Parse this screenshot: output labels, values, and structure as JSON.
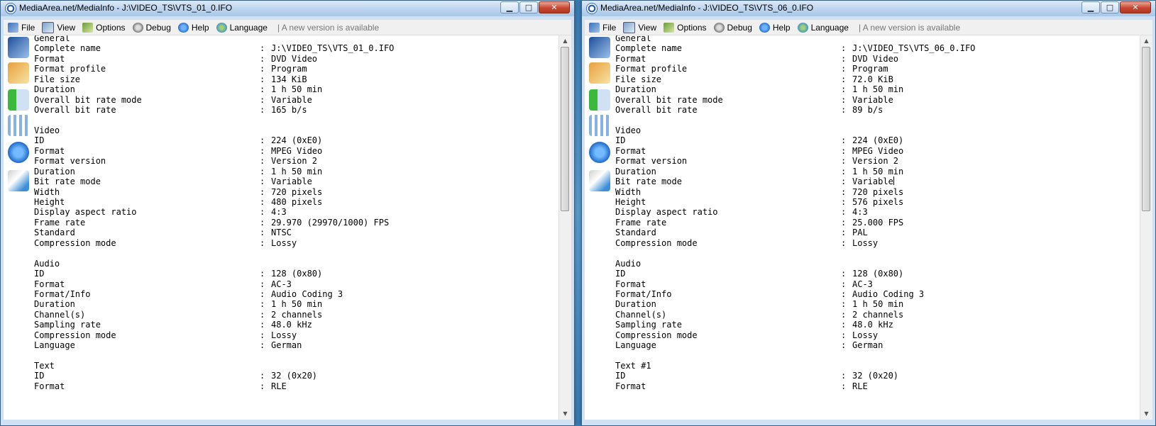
{
  "windows": [
    {
      "title": "MediaArea.net/MediaInfo - J:\\VIDEO_TS\\VTS_01_0.IFO",
      "caption_buttons": {
        "minimize": "▁",
        "maximize": "□",
        "close": "✕"
      },
      "menu": {
        "file": "File",
        "view": "View",
        "options": "Options",
        "debug": "Debug",
        "help": "Help",
        "language": "Language",
        "notice": "| A new version is available"
      },
      "report": [
        {
          "k": "General",
          "v": ""
        },
        {
          "k": "Complete name",
          "v": "J:\\VIDEO_TS\\VTS_01_0.IFO"
        },
        {
          "k": "Format",
          "v": "DVD Video"
        },
        {
          "k": "Format profile",
          "v": "Program"
        },
        {
          "k": "File size",
          "v": "134 KiB"
        },
        {
          "k": "Duration",
          "v": "1 h 50 min"
        },
        {
          "k": "Overall bit rate mode",
          "v": "Variable"
        },
        {
          "k": "Overall bit rate",
          "v": "165 b/s"
        },
        {
          "k": "",
          "v": ""
        },
        {
          "k": "Video",
          "v": ""
        },
        {
          "k": "ID",
          "v": "224 (0xE0)"
        },
        {
          "k": "Format",
          "v": "MPEG Video"
        },
        {
          "k": "Format version",
          "v": "Version 2"
        },
        {
          "k": "Duration",
          "v": "1 h 50 min"
        },
        {
          "k": "Bit rate mode",
          "v": "Variable"
        },
        {
          "k": "Width",
          "v": "720 pixels"
        },
        {
          "k": "Height",
          "v": "480 pixels"
        },
        {
          "k": "Display aspect ratio",
          "v": "4:3"
        },
        {
          "k": "Frame rate",
          "v": "29.970 (29970/1000) FPS"
        },
        {
          "k": "Standard",
          "v": "NTSC"
        },
        {
          "k": "Compression mode",
          "v": "Lossy"
        },
        {
          "k": "",
          "v": ""
        },
        {
          "k": "Audio",
          "v": ""
        },
        {
          "k": "ID",
          "v": "128 (0x80)"
        },
        {
          "k": "Format",
          "v": "AC-3"
        },
        {
          "k": "Format/Info",
          "v": "Audio Coding 3"
        },
        {
          "k": "Duration",
          "v": "1 h 50 min"
        },
        {
          "k": "Channel(s)",
          "v": "2 channels"
        },
        {
          "k": "Sampling rate",
          "v": "48.0 kHz"
        },
        {
          "k": "Compression mode",
          "v": "Lossy"
        },
        {
          "k": "Language",
          "v": "German"
        },
        {
          "k": "",
          "v": ""
        },
        {
          "k": "Text",
          "v": ""
        },
        {
          "k": "ID",
          "v": "32 (0x20)"
        },
        {
          "k": "Format",
          "v": "RLE"
        }
      ]
    },
    {
      "title": "MediaArea.net/MediaInfo - J:\\VIDEO_TS\\VTS_06_0.IFO",
      "caption_buttons": {
        "minimize": "▁",
        "maximize": "□",
        "close": "✕"
      },
      "menu": {
        "file": "File",
        "view": "View",
        "options": "Options",
        "debug": "Debug",
        "help": "Help",
        "language": "Language",
        "notice": "| A new version is available"
      },
      "report": [
        {
          "k": "General",
          "v": ""
        },
        {
          "k": "Complete name",
          "v": "J:\\VIDEO_TS\\VTS_06_0.IFO"
        },
        {
          "k": "Format",
          "v": "DVD Video"
        },
        {
          "k": "Format profile",
          "v": "Program"
        },
        {
          "k": "File size",
          "v": "72.0 KiB"
        },
        {
          "k": "Duration",
          "v": "1 h 50 min"
        },
        {
          "k": "Overall bit rate mode",
          "v": "Variable"
        },
        {
          "k": "Overall bit rate",
          "v": "89 b/s"
        },
        {
          "k": "",
          "v": ""
        },
        {
          "k": "Video",
          "v": ""
        },
        {
          "k": "ID",
          "v": "224 (0xE0)"
        },
        {
          "k": "Format",
          "v": "MPEG Video"
        },
        {
          "k": "Format version",
          "v": "Version 2"
        },
        {
          "k": "Duration",
          "v": "1 h 50 min"
        },
        {
          "k": "Bit rate mode",
          "v": "Variable"
        },
        {
          "k": "Width",
          "v": "720 pixels"
        },
        {
          "k": "Height",
          "v": "576 pixels"
        },
        {
          "k": "Display aspect ratio",
          "v": "4:3"
        },
        {
          "k": "Frame rate",
          "v": "25.000 FPS"
        },
        {
          "k": "Standard",
          "v": "PAL"
        },
        {
          "k": "Compression mode",
          "v": "Lossy"
        },
        {
          "k": "",
          "v": ""
        },
        {
          "k": "Audio",
          "v": ""
        },
        {
          "k": "ID",
          "v": "128 (0x80)"
        },
        {
          "k": "Format",
          "v": "AC-3"
        },
        {
          "k": "Format/Info",
          "v": "Audio Coding 3"
        },
        {
          "k": "Duration",
          "v": "1 h 50 min"
        },
        {
          "k": "Channel(s)",
          "v": "2 channels"
        },
        {
          "k": "Sampling rate",
          "v": "48.0 kHz"
        },
        {
          "k": "Compression mode",
          "v": "Lossy"
        },
        {
          "k": "Language",
          "v": "German"
        },
        {
          "k": "",
          "v": ""
        },
        {
          "k": "Text #1",
          "v": ""
        },
        {
          "k": "ID",
          "v": "32 (0x20)"
        },
        {
          "k": "Format",
          "v": "RLE"
        }
      ]
    }
  ],
  "sidebar_icons": [
    "sheet-view-icon",
    "html-view-icon",
    "text-view-icon",
    "tree-view-icon",
    "info-icon",
    "compare-icon"
  ],
  "scroll_arrows": {
    "up": "▲",
    "down": "▼"
  },
  "separator": ":"
}
